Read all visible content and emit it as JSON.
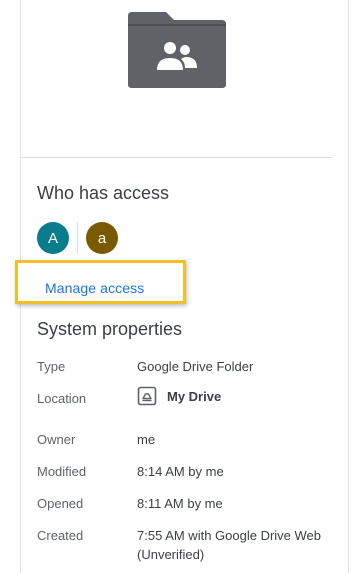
{
  "preview": {
    "icon": "shared-folder-icon",
    "folder_color": "#5f6368"
  },
  "access": {
    "title": "Who has access",
    "avatars": [
      {
        "initial": "A",
        "color": "#0a7d8c"
      },
      {
        "initial": "a",
        "color": "#7a5a00"
      }
    ],
    "manage_label": "Manage access",
    "highlight_color": "#f2bf28",
    "link_color": "#1a73e8"
  },
  "system": {
    "title": "System properties",
    "type_label": "Type",
    "type_value": "Google Drive Folder",
    "location_label": "Location",
    "location_value": "My Drive",
    "location_icon": "drive-icon",
    "owner_label": "Owner",
    "owner_value": "me",
    "modified_label": "Modified",
    "modified_value": "8:14 AM by me",
    "opened_label": "Opened",
    "opened_value": "8:11 AM by me",
    "created_label": "Created",
    "created_value": "7:55 AM with Google Drive Web (Unverified)"
  }
}
